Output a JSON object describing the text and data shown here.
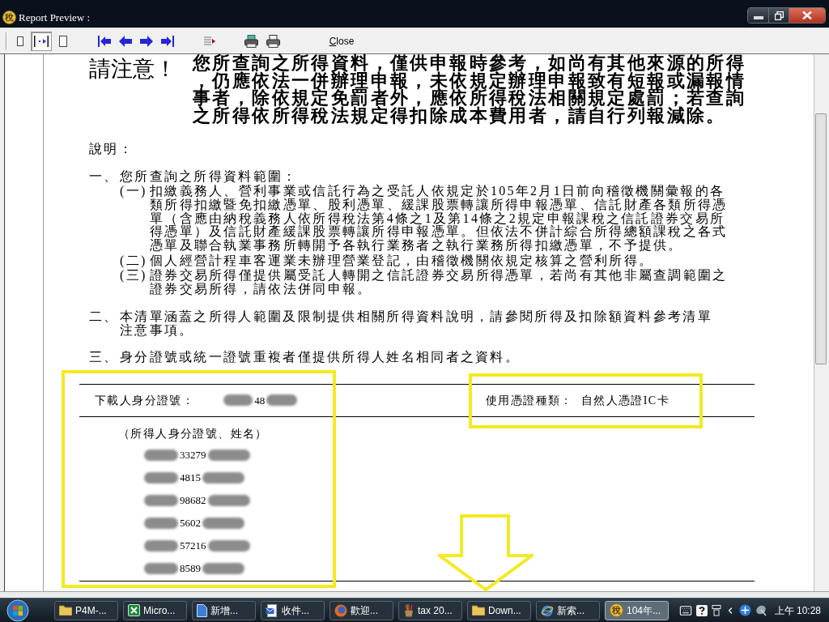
{
  "window": {
    "icon_glyph": "稅",
    "title": "Report Preview :"
  },
  "toolbar": {
    "view_modes": [
      {
        "kind": "one-page",
        "selected": false
      },
      {
        "kind": "page-width",
        "selected": true
      },
      {
        "kind": "full-page",
        "selected": false
      }
    ],
    "close_label": "Close"
  },
  "notice": {
    "heading": "請注意！",
    "text": "您所查詢之所得資料，僅供申報時參考，如尚有其他來源的所得，仍應依法一併辦理申報，未依規定辦理申報致有短報或漏報情事者，除依規定免罰者外，應依所得稅法相關規定處罰；若查詢之所得依所得稅法規定得扣除成本費用者，請自行列報減除。"
  },
  "explanation": {
    "title": "說明：",
    "items": [
      {
        "label": "一、",
        "text": "您所查詢之所得資料範圍：",
        "children": [
          {
            "label": "(一)",
            "text": "扣繳義務人、營利事業或信託行為之受託人依規定於105年2月1日前向稽徵機關彙報的各類所得扣繳暨免扣繳憑單、股利憑單、緩課股票轉讓所得申報憑單、信託財產各類所得憑單（含應由納稅義務人依所得稅法第4條之1及第14條之2規定申報課稅之信託證券交易所得憑單）及信託財產緩課股票轉讓所得申報憑單。但依法不併計綜合所得總額課稅之各式憑單及聯合執業事務所轉開予各執行業務者之執行業務所得扣繳憑單，不予提供。"
          },
          {
            "label": "(二)",
            "text": "個人經營計程車客運業未辦理營業登記，由稽徵機關依規定核算之營利所得。"
          },
          {
            "label": "(三)",
            "text": "證券交易所得僅提供屬受託人轉開之信託證券交易所得憑單，若尚有其他非屬查調範圍之證券交易所得，請依法併同申報。"
          }
        ]
      },
      {
        "label": "二、",
        "text": "本清單涵蓋之所得人範圍及限制提供相關所得資料說明，請參閱所得及扣除額資料參考清單注意事項。"
      },
      {
        "label": "三、",
        "text": "身分證號或統一證號重複者僅提供所得人姓名相同者之資料。"
      }
    ]
  },
  "downloader": {
    "id_label": "下載人身分證號：",
    "id_visible": "48",
    "certificate_label": "使用憑證種類：",
    "certificate_value": "自然人憑證IC卡"
  },
  "income_earners": {
    "header": "（所得人身分證號、姓名）",
    "rows": [
      {
        "id_visible": "33279"
      },
      {
        "id_visible": "4815"
      },
      {
        "id_visible": "98682"
      },
      {
        "id_visible": "5602"
      },
      {
        "id_visible": "57216"
      },
      {
        "id_visible": "8589"
      }
    ]
  },
  "taskbar": {
    "items": [
      {
        "kind": "folder",
        "label": "P4M-...",
        "selected": false
      },
      {
        "kind": "spreadsheet",
        "label": "Micro...",
        "selected": false
      },
      {
        "kind": "document",
        "label": "新增...",
        "selected": false
      },
      {
        "kind": "mail",
        "label": "收件...",
        "selected": false
      },
      {
        "kind": "browser-fox",
        "label": "歡迎...",
        "selected": false
      },
      {
        "kind": "pencil-cup",
        "label": "tax 20...",
        "selected": false
      },
      {
        "kind": "folder",
        "label": "Down...",
        "selected": false
      },
      {
        "kind": "browser-e",
        "label": "新索...",
        "selected": false
      },
      {
        "kind": "tax-app",
        "glyph": "稅",
        "label": "104年...",
        "selected": true
      }
    ],
    "clock": "上午 10:28"
  }
}
